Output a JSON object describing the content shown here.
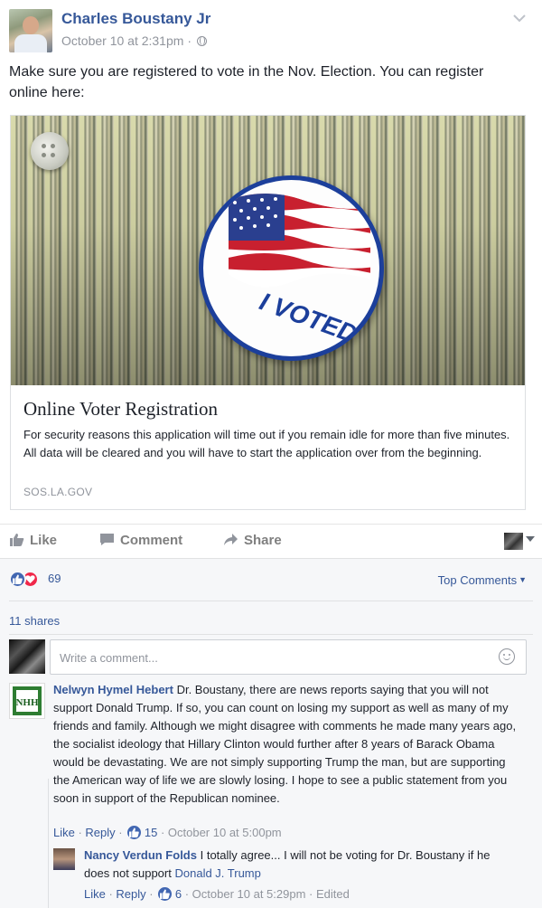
{
  "post": {
    "author": "Charles Boustany Jr",
    "timestamp": "October 10 at 2:31pm",
    "separator": "·",
    "privacy_icon": "globe-icon",
    "text": "Make sure you are registered to vote in the Nov. Election. You can register online here:"
  },
  "link_card": {
    "sticker_text": "I VOTED",
    "title": "Online Voter Registration",
    "description": "For security reasons this application will time out if you remain idle for more than five minutes. All data will be cleared and you will have to start the application over from the beginning.",
    "domain": "SOS.LA.GOV"
  },
  "actions": {
    "like": "Like",
    "comment": "Comment",
    "share": "Share"
  },
  "feedback": {
    "reaction_count": "69",
    "top_comments": "Top Comments",
    "shares": "11 shares",
    "composer_placeholder": "Write a comment..."
  },
  "comments": [
    {
      "author": "Nelwyn Hymel Hebert",
      "text": "Dr. Boustany, there are news reports saying that you will not support Donald Trump. If so, you can count on losing my support as well as many of my friends and family. Although we might disagree with comments he made many years ago, the socialist ideology that Hillary Clinton would further after 8 years of Barack Obama would be devastating. We are not simply supporting Trump the man, but are supporting the American way of life we are slowly losing. I hope to see a public statement from you soon in support of the Republican nominee.",
      "like": "Like",
      "reply": "Reply",
      "likes": "15",
      "time": "October 10 at 5:00pm",
      "avatar_text": "NHH"
    },
    {
      "author": "Nancy Verdun Folds",
      "text": "I totally agree... I will not be voting for Dr. Boustany if he does not support",
      "mention": "Donald J. Trump",
      "like": "Like",
      "reply": "Reply",
      "likes": "6",
      "time": "October 10 at 5:29pm",
      "edited": "Edited"
    }
  ],
  "colors": {
    "link": "#365899",
    "muted": "#90949c",
    "like_blue": "#4267b2",
    "love_red": "#f0284a"
  }
}
